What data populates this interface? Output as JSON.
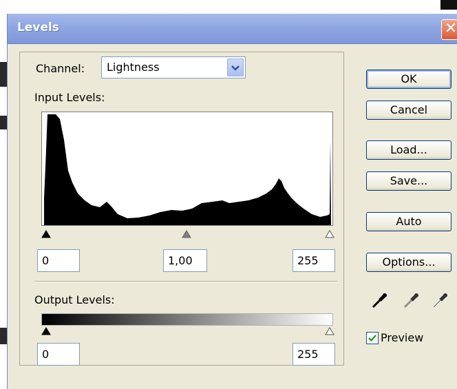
{
  "dialog": {
    "title": "Levels",
    "close_glyph": "✕"
  },
  "channel": {
    "label": "Channel:",
    "selected": "Lightness",
    "icon": "chevron-down-icon"
  },
  "input_levels": {
    "label": "Input Levels:",
    "black": "0",
    "gamma": "1,00",
    "white": "255"
  },
  "output_levels": {
    "label": "Output Levels:",
    "black": "0",
    "white": "255"
  },
  "buttons": {
    "ok": "OK",
    "cancel": "Cancel",
    "load": "Load...",
    "save": "Save...",
    "auto": "Auto",
    "options": "Options..."
  },
  "eyedroppers": [
    "black-eyedropper-icon",
    "gray-eyedropper-icon",
    "white-eyedropper-icon"
  ],
  "preview": {
    "label": "Preview",
    "checked": true
  },
  "colors": {
    "titlebar": "#8ea6e3",
    "dialog_bg": "#ece9d8",
    "button_border": "#003c74",
    "check": "#1e9b2c"
  }
}
